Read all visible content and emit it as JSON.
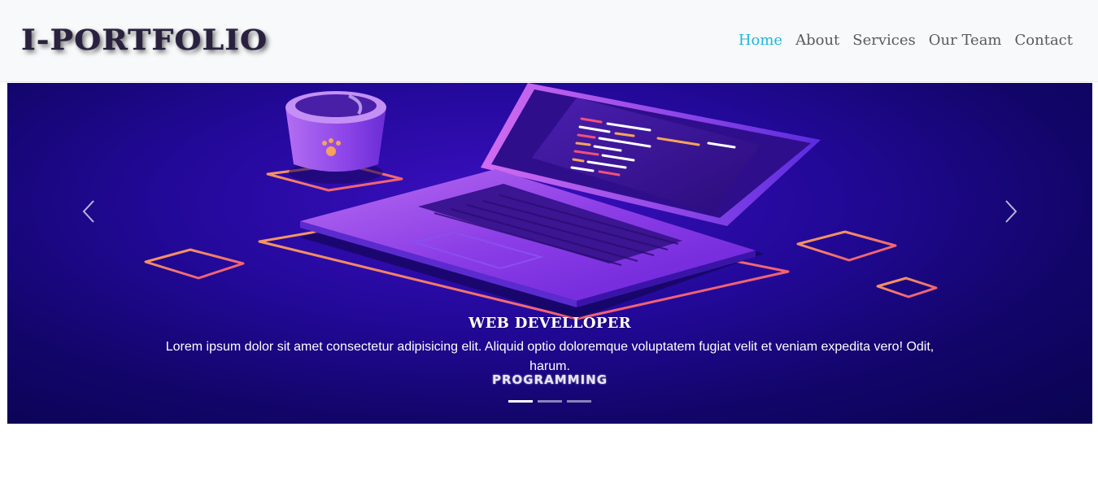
{
  "navbar": {
    "brand": "I-PORTFOLIO",
    "links": [
      {
        "label": "Home",
        "active": true
      },
      {
        "label": "About",
        "active": false
      },
      {
        "label": "Services",
        "active": false
      },
      {
        "label": "Our Team",
        "active": false
      },
      {
        "label": "Contact",
        "active": false
      }
    ]
  },
  "carousel": {
    "prev_icon": "chevron-left-icon",
    "next_icon": "chevron-right-icon",
    "caption": {
      "title": "WEB DEVELLOPER",
      "text": "Lorem ipsum dolor sit amet consectetur adipisicing elit. Aliquid optio doloremque voluptatem fugiat velit et veniam expedita vero! Odit, harum.",
      "tag": "PROGRAMMING"
    },
    "slide_count": 3,
    "active_slide": 1
  },
  "colors": {
    "nav_active": "#1fb6e0",
    "nav_text": "#5a5a5a",
    "hero_bg": "#12056a"
  }
}
